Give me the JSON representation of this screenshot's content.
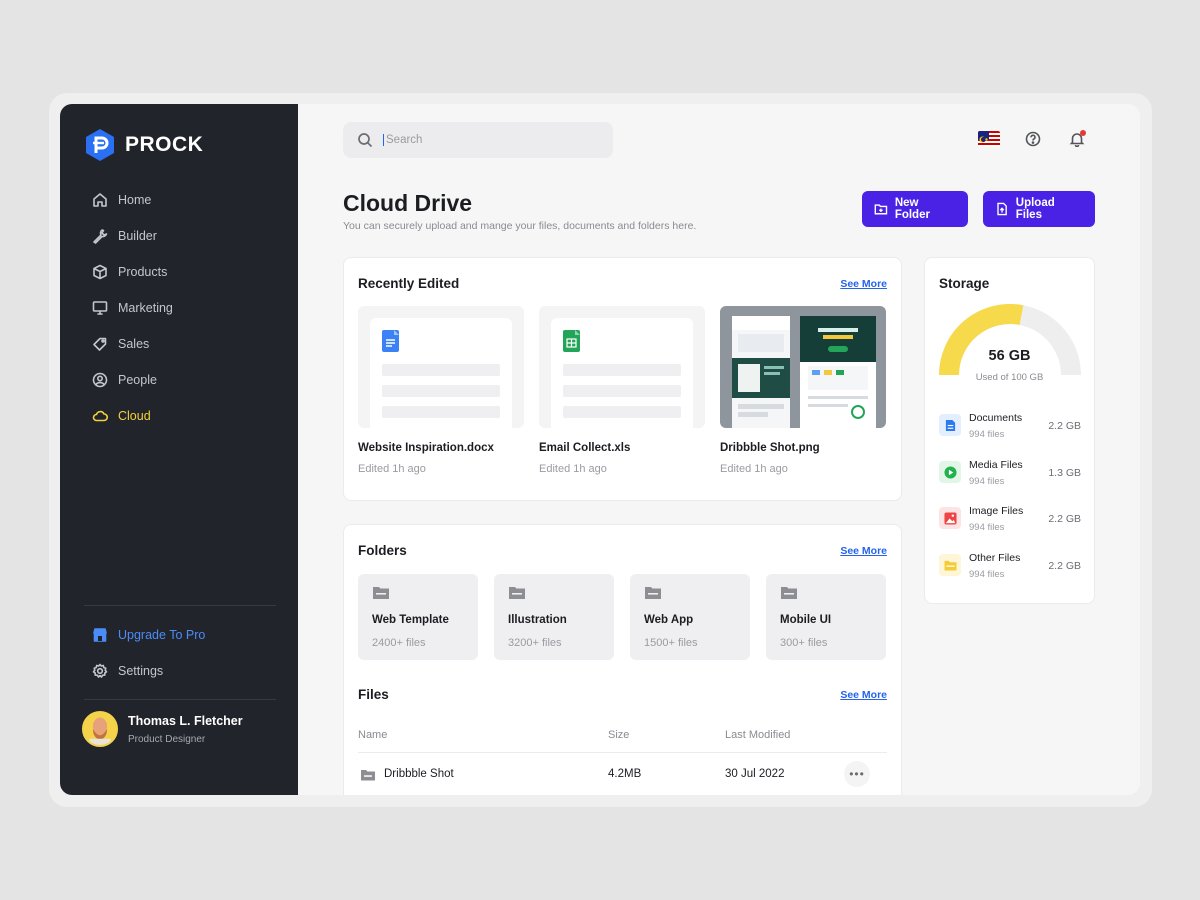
{
  "brand": {
    "name": "PROCK"
  },
  "sidebar": {
    "items": [
      {
        "label": "Home",
        "icon": "home-icon"
      },
      {
        "label": "Builder",
        "icon": "wrench-icon"
      },
      {
        "label": "Products",
        "icon": "box-icon"
      },
      {
        "label": "Marketing",
        "icon": "monitor-icon"
      },
      {
        "label": "Sales",
        "icon": "tag-icon"
      },
      {
        "label": "People",
        "icon": "user-circle-icon"
      },
      {
        "label": "Cloud",
        "icon": "cloud-icon",
        "active": true
      }
    ],
    "upgrade": {
      "label": "Upgrade To Pro",
      "icon": "store-icon",
      "color": "#4b8cf7"
    },
    "settings": {
      "label": "Settings",
      "icon": "gear-icon"
    },
    "user": {
      "name": "Thomas L. Fletcher",
      "role": "Product Designer"
    }
  },
  "header": {
    "search": {
      "placeholder": "Search",
      "value": ""
    },
    "icons": [
      "flag-icon",
      "help-icon",
      "bell-icon"
    ]
  },
  "page": {
    "title": "Cloud Drive",
    "subtitle": "You can securely upload and mange your files, documents and folders here.",
    "new_folder_label": "New Folder",
    "upload_label": "Upload Files",
    "accent": "#4a22e6"
  },
  "recent": {
    "title": "Recently Edited",
    "see_more": "See More",
    "items": [
      {
        "name": "Website Inspiration.docx",
        "edited": "Edited 1h ago",
        "icon": "docs-icon"
      },
      {
        "name": "Email Collect.xls",
        "edited": "Edited 1h ago",
        "icon": "sheets-icon"
      },
      {
        "name": "Dribbble Shot.png",
        "edited": "Edited 1h ago",
        "icon": "image-preview"
      }
    ]
  },
  "storage": {
    "title": "Storage",
    "used": "56 GB",
    "used_sub": "Used of 100 GB",
    "used_fraction": 0.56,
    "gauge_color": "#f7d94c",
    "items": [
      {
        "name": "Documents",
        "count": "994 files",
        "size": "2.2 GB",
        "icon": "document-icon",
        "color": "#2b7bf0"
      },
      {
        "name": "Media Files",
        "count": "994 files",
        "size": "1.3 GB",
        "icon": "play-icon",
        "color": "#22b14c"
      },
      {
        "name": "Image Files",
        "count": "994 files",
        "size": "2.2 GB",
        "icon": "image-icon",
        "color": "#ef4444"
      },
      {
        "name": "Other Files",
        "count": "994 files",
        "size": "2.2 GB",
        "icon": "folder-icon",
        "color": "#f5cc33"
      }
    ]
  },
  "folders": {
    "title": "Folders",
    "see_more": "See More",
    "items": [
      {
        "name": "Web Template",
        "count": "2400+ files"
      },
      {
        "name": "Illustration",
        "count": "3200+ files"
      },
      {
        "name": "Web App",
        "count": "1500+ files"
      },
      {
        "name": "Mobile UI",
        "count": "300+ files"
      }
    ]
  },
  "files": {
    "title": "Files",
    "see_more": "See More",
    "columns": [
      "Name",
      "Size",
      "Last Modified"
    ],
    "rows": [
      {
        "name": "Dribbble Shot",
        "size": "4.2MB",
        "modified": "30 Jul 2022"
      }
    ]
  }
}
